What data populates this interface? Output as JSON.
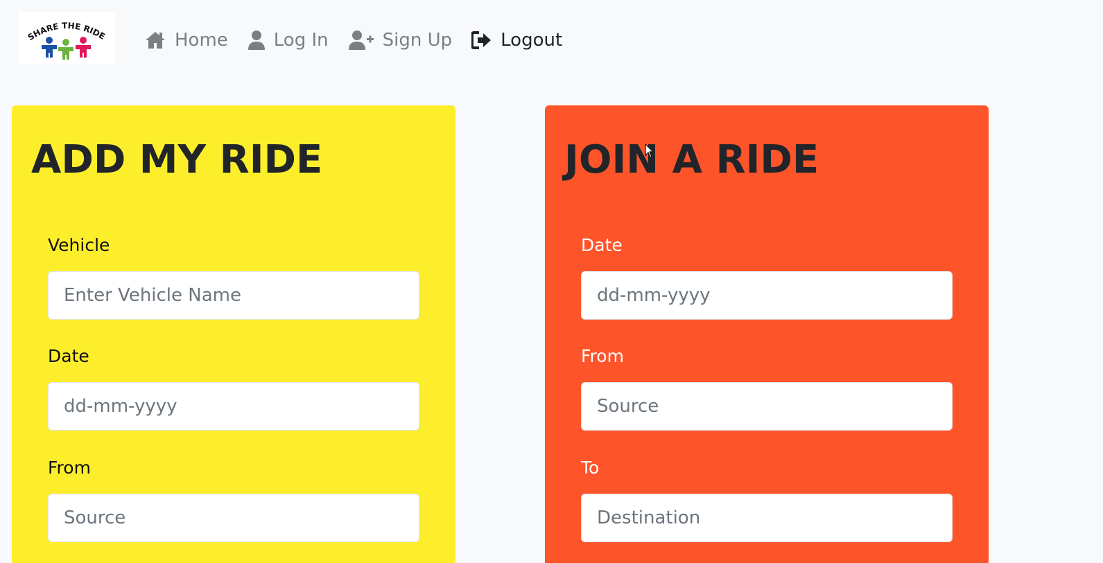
{
  "nav": {
    "logo_text": "SHARE THE RIDE",
    "items": [
      {
        "label": "Home",
        "icon": "home-icon"
      },
      {
        "label": "Log In",
        "icon": "user-icon"
      },
      {
        "label": "Sign Up",
        "icon": "user-plus-icon"
      },
      {
        "label": "Logout",
        "icon": "sign-out-icon"
      }
    ]
  },
  "add_ride": {
    "title": "ADD MY RIDE",
    "background": "#fdee2c",
    "vehicle_label": "Vehicle",
    "vehicle_placeholder": "Enter Vehicle Name",
    "date_label": "Date",
    "date_placeholder": "dd-mm-yyyy",
    "from_label": "From",
    "from_placeholder": "Source"
  },
  "join_ride": {
    "title": "JOIN A RIDE",
    "background": "#fe542a",
    "date_label": "Date",
    "date_placeholder": "dd-mm-yyyy",
    "from_label": "From",
    "from_placeholder": "Source",
    "to_label": "To",
    "to_placeholder": "Destination"
  }
}
